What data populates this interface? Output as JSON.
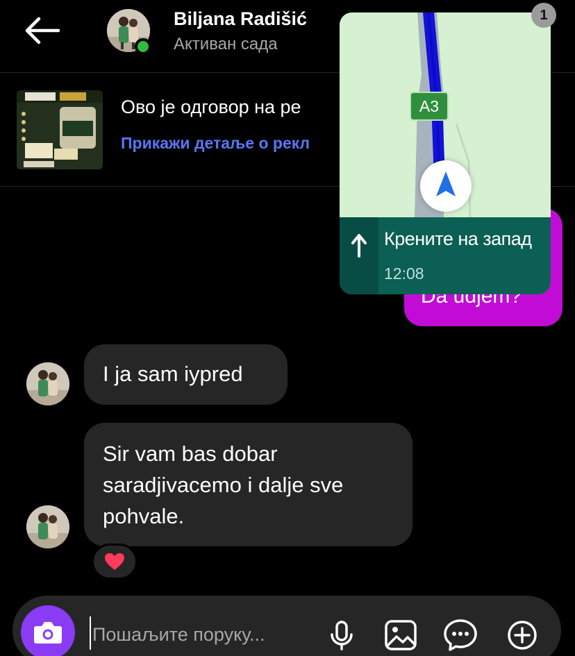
{
  "header": {
    "contact_name": "Biljana Radišić",
    "status": "Активан сада",
    "icons": {
      "back": "arrow-left-icon",
      "online": "online-dot"
    }
  },
  "ad_reply": {
    "title": "Ово је одговор на ре",
    "link_label": "Прикажи детаље о рекл"
  },
  "map_overlay": {
    "route_label": "A3",
    "instruction": "Крените на запад",
    "time": "12:08",
    "unread_count": "1"
  },
  "messages": [
    {
      "direction": "outgoing",
      "text": "Da udjem?"
    },
    {
      "direction": "incoming",
      "text": "I ja sam iypred"
    },
    {
      "direction": "incoming",
      "text": "Sir vam bas dobar saradjivacemo i dalje sve pohvale.",
      "reaction": "heart"
    }
  ],
  "composer": {
    "placeholder": "Пошаљите поруку..."
  },
  "colors": {
    "background": "#000000",
    "incoming_bubble": "#262626",
    "outgoing_bubble": "#c20cd6",
    "link": "#5876f7",
    "camera_button": "#8a3cf5",
    "online": "#2fbd3a"
  }
}
